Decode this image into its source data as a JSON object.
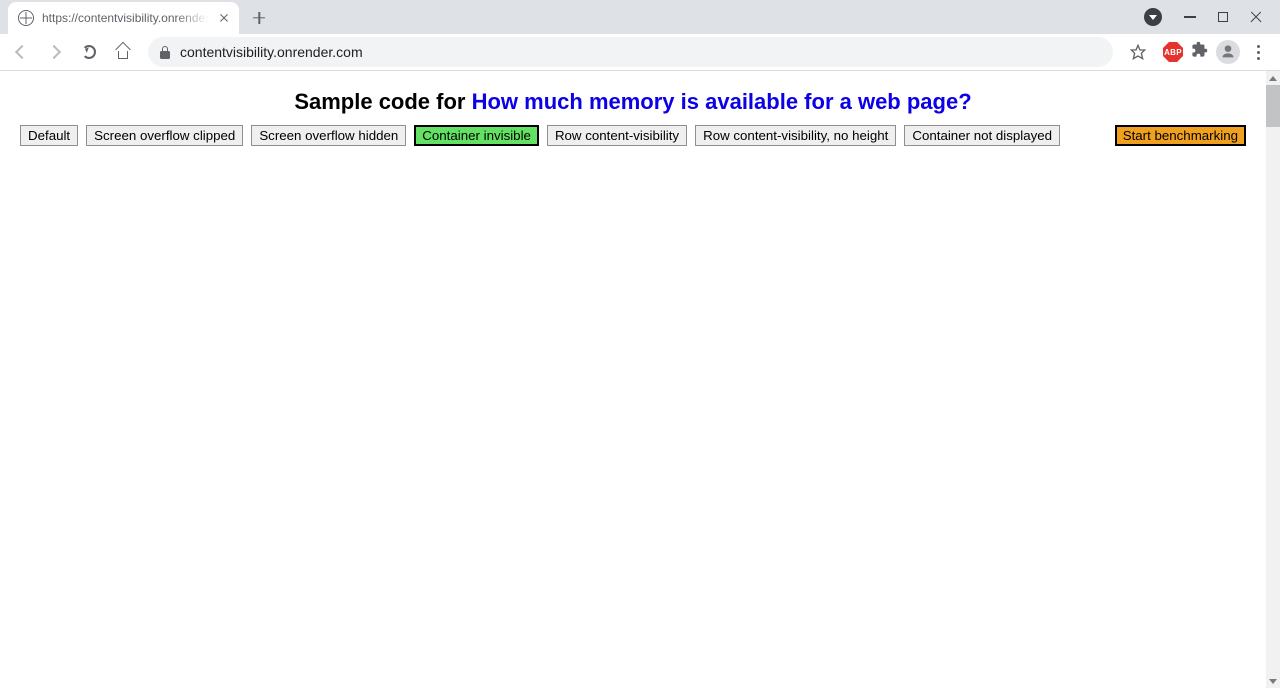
{
  "browser": {
    "tab_title": "https://contentvisibility.onrender",
    "url": "contentvisibility.onrender.com",
    "abp_label": "ABP"
  },
  "page": {
    "heading_prefix": "Sample code for ",
    "heading_link": "How much memory is available for a web page?",
    "buttons": [
      {
        "label": "Default",
        "active": false
      },
      {
        "label": "Screen overflow clipped",
        "active": false
      },
      {
        "label": "Screen overflow hidden",
        "active": false
      },
      {
        "label": "Container invisible",
        "active": true
      },
      {
        "label": "Row content-visibility",
        "active": false
      },
      {
        "label": "Row content-visibility, no height",
        "active": false
      },
      {
        "label": "Container not displayed",
        "active": false
      }
    ],
    "benchmark_label": "Start benchmarking"
  }
}
